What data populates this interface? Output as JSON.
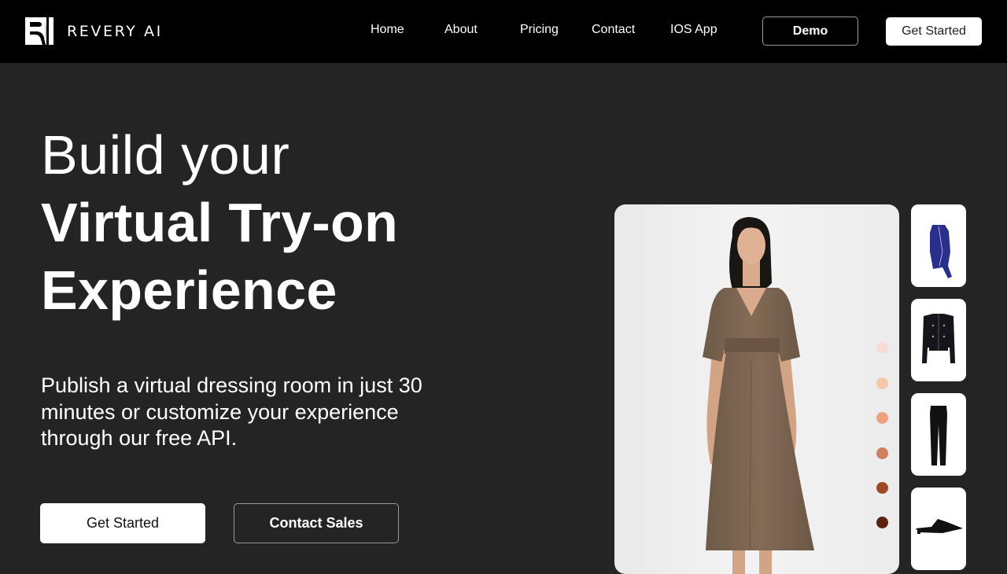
{
  "header": {
    "brand": "REVERY AI",
    "logo_icon": "revery-logo-mark",
    "nav": [
      {
        "label": "Home"
      },
      {
        "label": "About"
      },
      {
        "label": "Pricing"
      },
      {
        "label": "Contact"
      },
      {
        "label": "IOS App"
      }
    ],
    "demo_label": "Demo",
    "get_started_label": "Get Started"
  },
  "hero": {
    "headline_line1": "Build your",
    "headline_line2": "Virtual Try-on",
    "headline_line3": "Experience",
    "subtext": "Publish a virtual dressing room in just 30 minutes or customize your experience through our free API.",
    "primary_cta": "Get Started",
    "secondary_cta": "Contact Sales"
  },
  "preview": {
    "model_image": "model-wearing-brown-wrap-midi-dress",
    "skin_tones": [
      "#f9dcd8",
      "#f3c9ac",
      "#eaa37e",
      "#cf805d",
      "#9b4a25",
      "#5a2210"
    ],
    "garments": [
      {
        "name": "blue-satin-wrap-dress",
        "color": "#2b2f8c"
      },
      {
        "name": "black-tweed-jacket",
        "color": "#15151c"
      },
      {
        "name": "black-trousers",
        "color": "#111111"
      },
      {
        "name": "black-pointed-mule",
        "color": "#111111"
      }
    ]
  },
  "colors": {
    "header_bg": "#000000",
    "page_bg": "#242424",
    "text": "#ffffff",
    "button_border": "#9a9a9a",
    "dress": "#7b6551"
  }
}
